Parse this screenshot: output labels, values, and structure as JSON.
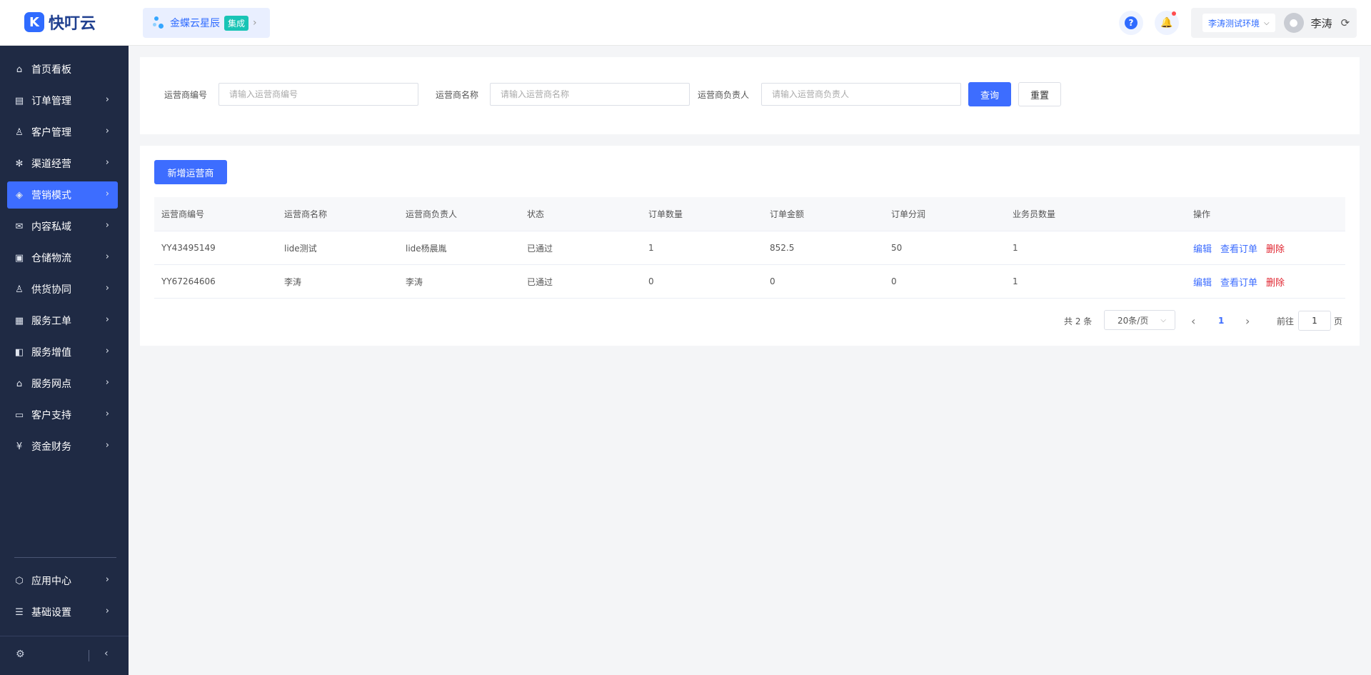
{
  "app": {
    "logo_mark": "K",
    "logo_text": "快叮云"
  },
  "integration": {
    "label": "金蝶云星辰",
    "tag": "集成",
    "arrow": "›"
  },
  "header": {
    "help_glyph": "?",
    "bell_glyph": "🔔",
    "env_label": "李涛测试环境",
    "env_chevron": "⌵",
    "avatar_glyph": "●",
    "username": "李涛",
    "refresh_glyph": "⟳"
  },
  "sidebar": {
    "items": [
      {
        "label": "首页看板",
        "icon": "⌂",
        "has_children": false
      },
      {
        "label": "订单管理",
        "icon": "▤",
        "has_children": true
      },
      {
        "label": "客户管理",
        "icon": "♙",
        "has_children": true
      },
      {
        "label": "渠道经营",
        "icon": "✻",
        "has_children": true
      },
      {
        "label": "营销模式",
        "icon": "◈",
        "has_children": true,
        "active": true
      },
      {
        "label": "内容私域",
        "icon": "✉",
        "has_children": true
      },
      {
        "label": "仓储物流",
        "icon": "▣",
        "has_children": true
      },
      {
        "label": "供货协同",
        "icon": "♙",
        "has_children": true
      },
      {
        "label": "服务工单",
        "icon": "▦",
        "has_children": true
      },
      {
        "label": "服务增值",
        "icon": "◧",
        "has_children": true
      },
      {
        "label": "服务网点",
        "icon": "⌂",
        "has_children": true
      },
      {
        "label": "客户支持",
        "icon": "▭",
        "has_children": true
      },
      {
        "label": "资金财务",
        "icon": "¥",
        "has_children": true
      }
    ],
    "bottom_items": [
      {
        "label": "应用中心",
        "icon": "⬡",
        "has_children": true
      },
      {
        "label": "基础设置",
        "icon": "☰",
        "has_children": true
      }
    ],
    "chevron": "›",
    "footer_gear": "⚙",
    "footer_collapse": "‹"
  },
  "search": {
    "fields": [
      {
        "label": "运营商编号",
        "placeholder": "请输入运营商编号",
        "value": ""
      },
      {
        "label": "运营商名称",
        "placeholder": "请输入运营商名称",
        "value": ""
      },
      {
        "label": "运营商负责人",
        "placeholder": "请输入运营商负责人",
        "value": ""
      }
    ],
    "query_label": "查询",
    "reset_label": "重置"
  },
  "table": {
    "add_label": "新增运营商",
    "columns": [
      "运营商编号",
      "运营商名称",
      "运营商负责人",
      "状态",
      "订单数量",
      "订单金额",
      "订单分润",
      "业务员数量",
      "操作"
    ],
    "rows": [
      [
        "YY43495149",
        "lide测试",
        "lide杨晨胤",
        "已通过",
        "1",
        "852.5",
        "50",
        "1"
      ],
      [
        "YY67264606",
        "李涛",
        "李涛",
        "已通过",
        "0",
        "0",
        "0",
        "1"
      ]
    ],
    "actions": {
      "edit": "编辑",
      "view_orders": "查看订单",
      "delete": "删除"
    }
  },
  "pagination": {
    "total_text": "共 2 条",
    "page_size": "20条/页",
    "page_size_chevron": "⌵",
    "prev": "‹",
    "current_page": "1",
    "next": "›",
    "goto_label": "前往",
    "goto_value": "1",
    "page_suffix": "页"
  },
  "colors": {
    "primary": "#3d6dff",
    "sidebar_bg": "#1f2a44",
    "danger": "#e0242f",
    "tag": "#19c4b5"
  }
}
